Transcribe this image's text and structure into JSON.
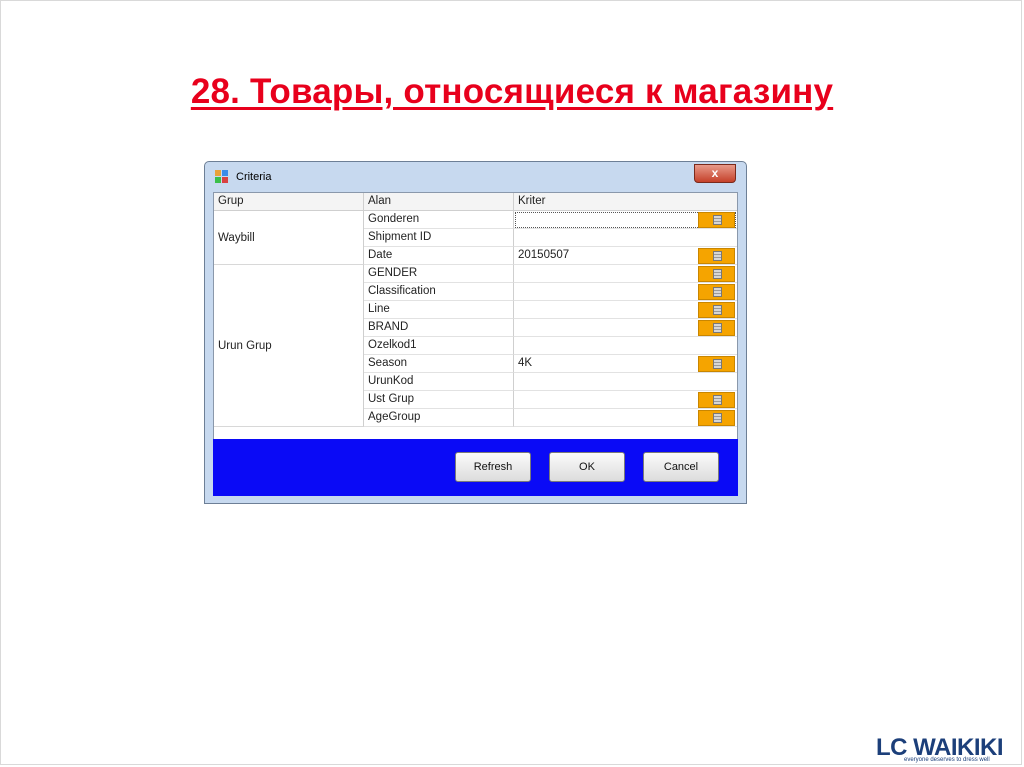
{
  "slide": {
    "title": "28. Товары, относящиеся к магазину"
  },
  "window": {
    "title": "Criteria",
    "close_label": "x"
  },
  "grid": {
    "headers": {
      "group": "Grup",
      "alan": "Alan",
      "kriter": "Kriter"
    },
    "groups": [
      {
        "label": "Waybill"
      },
      {
        "label": "Urun Grup"
      }
    ],
    "rows": [
      {
        "alan": "Gonderen",
        "kriter": "",
        "has_picker": true,
        "focused": true
      },
      {
        "alan": "Shipment ID",
        "kriter": "",
        "has_picker": false
      },
      {
        "alan": "Date",
        "kriter": "20150507",
        "has_picker": true
      },
      {
        "alan": "GENDER",
        "kriter": "",
        "has_picker": true
      },
      {
        "alan": "Classification",
        "kriter": "",
        "has_picker": true
      },
      {
        "alan": "Line",
        "kriter": "",
        "has_picker": true
      },
      {
        "alan": "BRAND",
        "kriter": "",
        "has_picker": true
      },
      {
        "alan": "Ozelkod1",
        "kriter": "",
        "has_picker": false
      },
      {
        "alan": "Season",
        "kriter": "4K",
        "has_picker": true
      },
      {
        "alan": "UrunKod",
        "kriter": "",
        "has_picker": false
      },
      {
        "alan": "Ust Grup",
        "kriter": "",
        "has_picker": true
      },
      {
        "alan": "AgeGroup",
        "kriter": "",
        "has_picker": true
      }
    ]
  },
  "buttons": {
    "refresh": "Refresh",
    "ok": "OK",
    "cancel": "Cancel"
  },
  "brand": {
    "logo": "LC WAIKIKI",
    "tagline": "everyone deserves to dress well",
    "color": "#1c3f7a"
  },
  "colors": {
    "title_red": "#e8001c",
    "panel_blue": "#0a0af6",
    "picker_orange": "#f5a400"
  }
}
